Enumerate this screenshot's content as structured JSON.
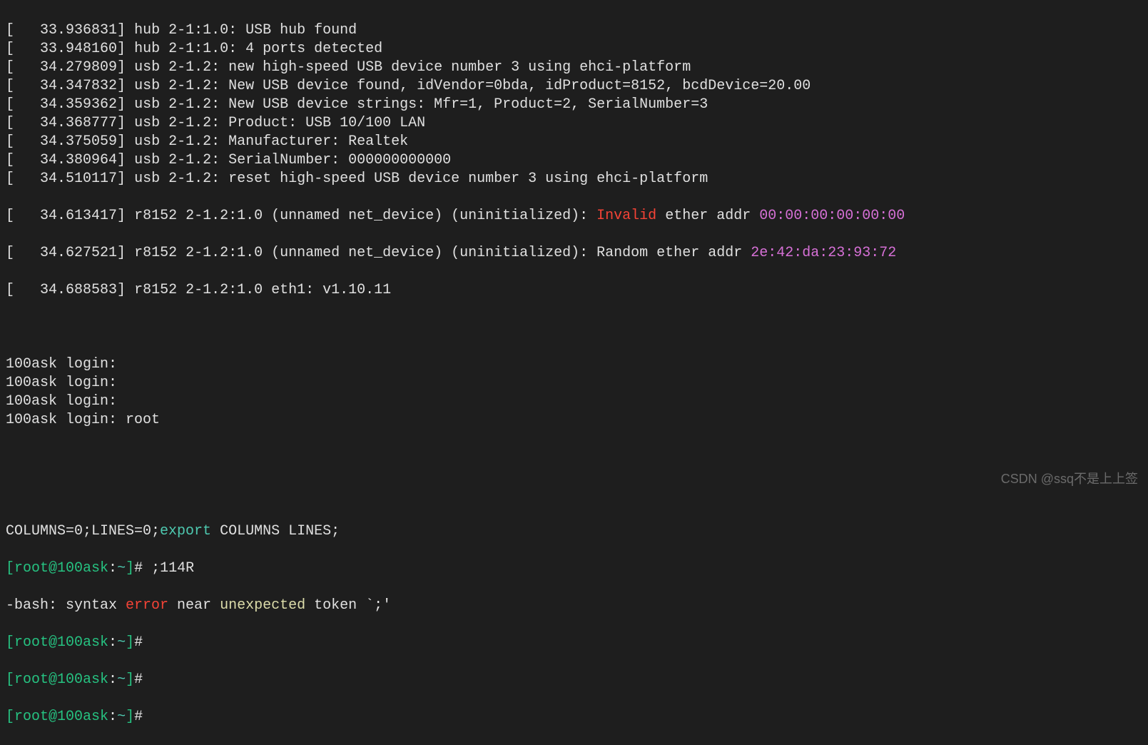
{
  "kernel_lines": [
    {
      "ts": "33.936831",
      "text": "hub 2-1:1.0: USB hub found"
    },
    {
      "ts": "33.948160",
      "text": "hub 2-1:1.0: 4 ports detected"
    },
    {
      "ts": "34.279809",
      "text": "usb 2-1.2: new high-speed USB device number 3 using ehci-platform"
    },
    {
      "ts": "34.347832",
      "text": "usb 2-1.2: New USB device found, idVendor=0bda, idProduct=8152, bcdDevice=20.00"
    },
    {
      "ts": "34.359362",
      "text": "usb 2-1.2: New USB device strings: Mfr=1, Product=2, SerialNumber=3"
    },
    {
      "ts": "34.368777",
      "text": "usb 2-1.2: Product: USB 10/100 LAN"
    },
    {
      "ts": "34.375059",
      "text": "usb 2-1.2: Manufacturer: Realtek"
    },
    {
      "ts": "34.380964",
      "text": "usb 2-1.2: SerialNumber: 000000000000"
    },
    {
      "ts": "34.510117",
      "text": "usb 2-1.2: reset high-speed USB device number 3 using ehci-platform"
    }
  ],
  "invalid_line": {
    "ts": "34.613417",
    "prefix": "r8152 2-1.2:1.0 (unnamed net_device) (uninitialized): ",
    "invalid": "Invalid",
    "mid": " ether addr ",
    "mac": "00:00:00:00:00:00"
  },
  "random_line": {
    "ts": "34.627521",
    "prefix": "r8152 2-1.2:1.0 (unnamed net_device) (uninitialized): Random ether addr ",
    "mac": "2e:42:da:23:93:72"
  },
  "last_kernel": {
    "ts": "34.688583",
    "text": "r8152 2-1.2:1.0 eth1: v1.10.11"
  },
  "login_lines": [
    "100ask login:",
    "100ask login:",
    "100ask login:",
    "100ask login: root"
  ],
  "export_line": {
    "prefix": "COLUMNS=0;LINES=0;",
    "export": "export",
    "suffix": " COLUMNS LINES;"
  },
  "prompt": {
    "bracket_open": "[",
    "user_host": "root@100ask",
    "colon": ":",
    "path": "~",
    "bracket_close": "]",
    "hash": "#"
  },
  "cmd1": " ;114R",
  "bash_error": {
    "prefix": "-bash: syntax ",
    "error": "error",
    "mid": " near ",
    "unexpected": "unexpected",
    "suffix": " token `;'"
  },
  "watermark": "CSDN @ssq不是上上签"
}
